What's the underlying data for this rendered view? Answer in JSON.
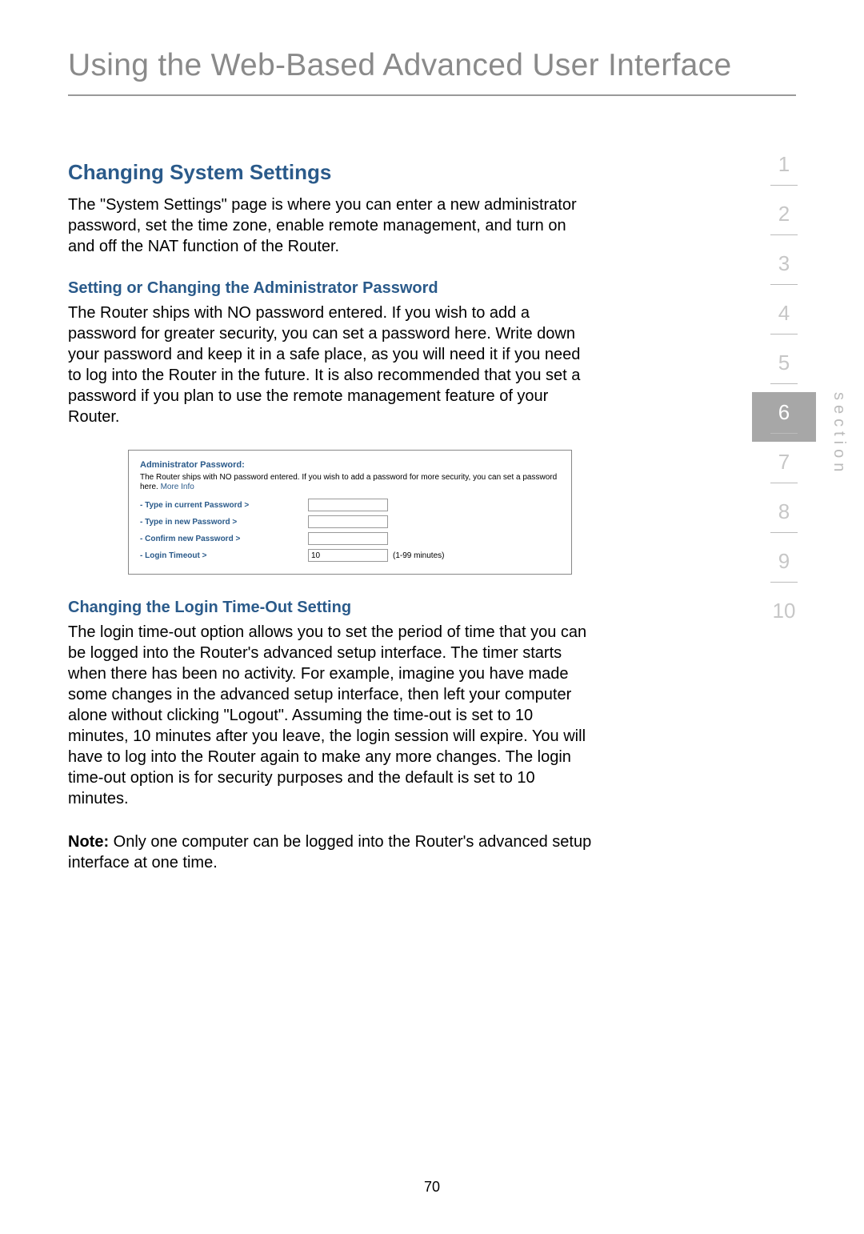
{
  "header": "Using the Web-Based Advanced User Interface",
  "section1": {
    "title": "Changing System Settings",
    "body": "The \"System Settings\" page is where you can enter a new administrator password, set the time zone, enable remote management, and turn on and off the NAT function of the Router."
  },
  "section2": {
    "title": "Setting or Changing the Administrator Password",
    "body": "The Router ships with NO password entered. If you wish to add a password for greater security, you can set a password here. Write down your password and keep it in a safe place, as you will need it if you need to log into the Router in the future. It is also recommended that you set a password if you plan to use the remote management feature of your Router."
  },
  "screenshot": {
    "heading": "Administrator Password:",
    "desc_prefix": "The Router ships with NO password entered. If you wish to add a password for more security, you can set a password here. ",
    "more_info": "More Info",
    "rows": {
      "current": "- Type in current Password >",
      "new": "- Type in new Password >",
      "confirm": "- Confirm new Password >",
      "timeout": "- Login Timeout >"
    },
    "timeout_value": "10",
    "timeout_suffix": "(1-99 minutes)"
  },
  "section3": {
    "title": "Changing the Login Time-Out Setting",
    "body": "The login time-out option allows you to set the period of time that you can be logged into the Router's advanced setup interface. The timer starts when there has been no activity. For example, imagine you have made some changes in the advanced setup interface, then left your computer alone without clicking \"Logout\". Assuming the time-out is set to 10 minutes, 10 minutes after you leave, the login session will expire. You will have to log into the Router again to make any more changes. The login time-out option is for security purposes and the default is set to 10 minutes."
  },
  "note": {
    "label": "Note:",
    "body": " Only one computer can be logged into the Router's advanced setup interface at one time."
  },
  "nav": {
    "items": [
      "1",
      "2",
      "3",
      "4",
      "5",
      "6",
      "7",
      "8",
      "9",
      "10"
    ],
    "active_index": 5,
    "label": "section"
  },
  "page_number": "70"
}
